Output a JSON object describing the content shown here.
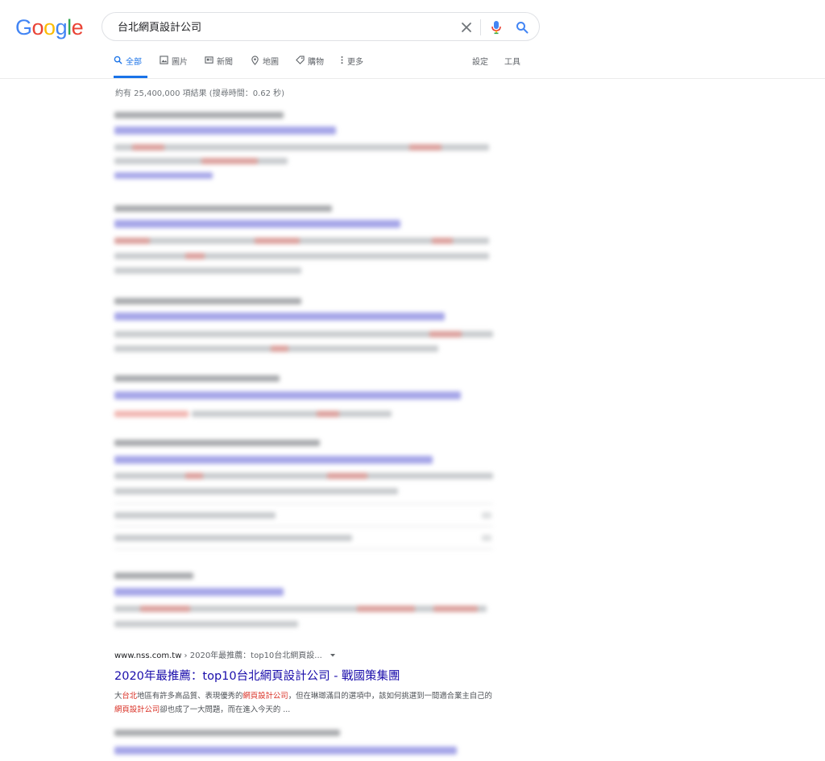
{
  "logo": {
    "text": "Google"
  },
  "search": {
    "query": "台北網頁設計公司"
  },
  "icons": {
    "clear": "close-icon",
    "voice": "mic-icon",
    "search": "search-icon"
  },
  "tabs": [
    {
      "label": "全部",
      "icon": "search-icon",
      "active": true
    },
    {
      "label": "圖片",
      "icon": "image-icon"
    },
    {
      "label": "新聞",
      "icon": "news-icon"
    },
    {
      "label": "地圖",
      "icon": "map-pin-icon"
    },
    {
      "label": "購物",
      "icon": "tag-icon"
    },
    {
      "label": "更多",
      "icon": "more-vert-icon"
    }
  ],
  "tools": {
    "settings": "設定",
    "tools": "工具"
  },
  "stats": "約有 25,400,000 項結果 (搜尋時間：0.62 秒)",
  "result": {
    "cite_domain": "www.nss.com.tw",
    "cite_path": " › 2020年最推薦：top10台北網頁設...",
    "title": "2020年最推薦：top10台北網頁設計公司 - 戰國策集團",
    "snippet": {
      "p1": "大",
      "h1": "台北",
      "p2": "地區有許多高品質、表現優秀的",
      "h2": "網頁設計公司",
      "p3": "，但在琳瑯滿目的選項中，該如何挑選到一間適合業主自己的",
      "h3": "網頁設計公司",
      "p4": "卻也成了一大問題，而在進入今天的 ..."
    }
  },
  "colors": {
    "link": "#1a0dab",
    "accent": "#1a73e8",
    "highlight": "#d93025"
  }
}
